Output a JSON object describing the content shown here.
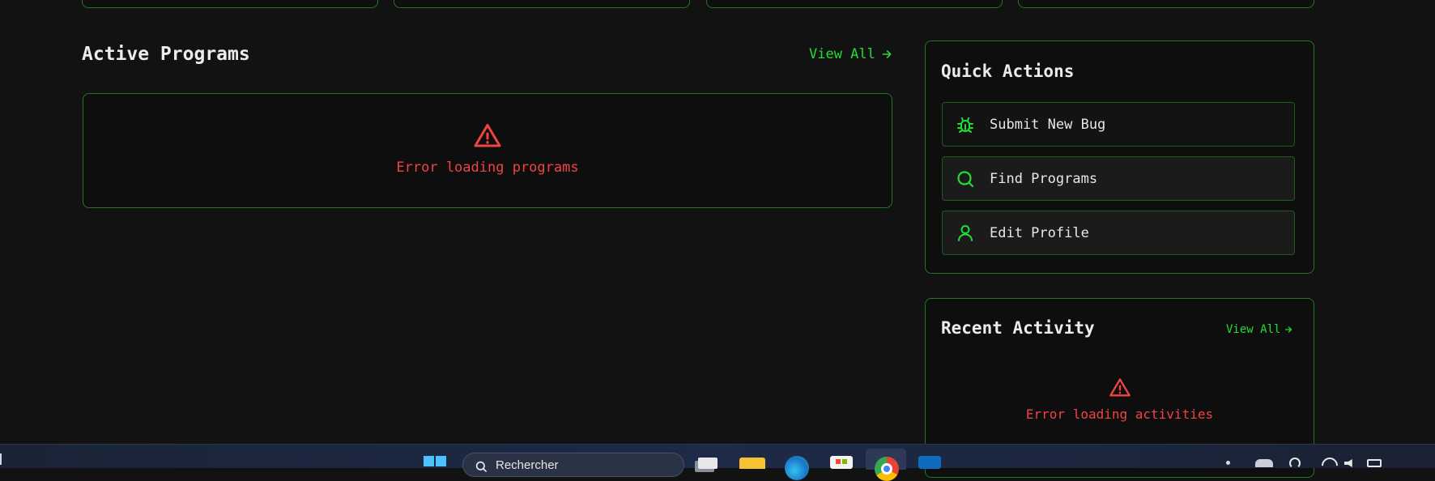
{
  "programs": {
    "title": "Active Programs",
    "view_all": "View All",
    "error": "Error loading programs"
  },
  "quick_actions": {
    "title": "Quick Actions",
    "items": [
      {
        "label": "Submit New Bug",
        "icon": "bug-icon"
      },
      {
        "label": "Find Programs",
        "icon": "search-icon"
      },
      {
        "label": "Edit Profile",
        "icon": "user-icon"
      }
    ]
  },
  "recent_activity": {
    "title": "Recent Activity",
    "view_all": "View All",
    "error": "Error loading activities"
  },
  "taskbar": {
    "search_placeholder": "Rechercher"
  },
  "colors": {
    "background": "#121212",
    "accent_green": "#22dd33",
    "border_green": "#1f7a1f",
    "error_red": "#ef4444"
  }
}
